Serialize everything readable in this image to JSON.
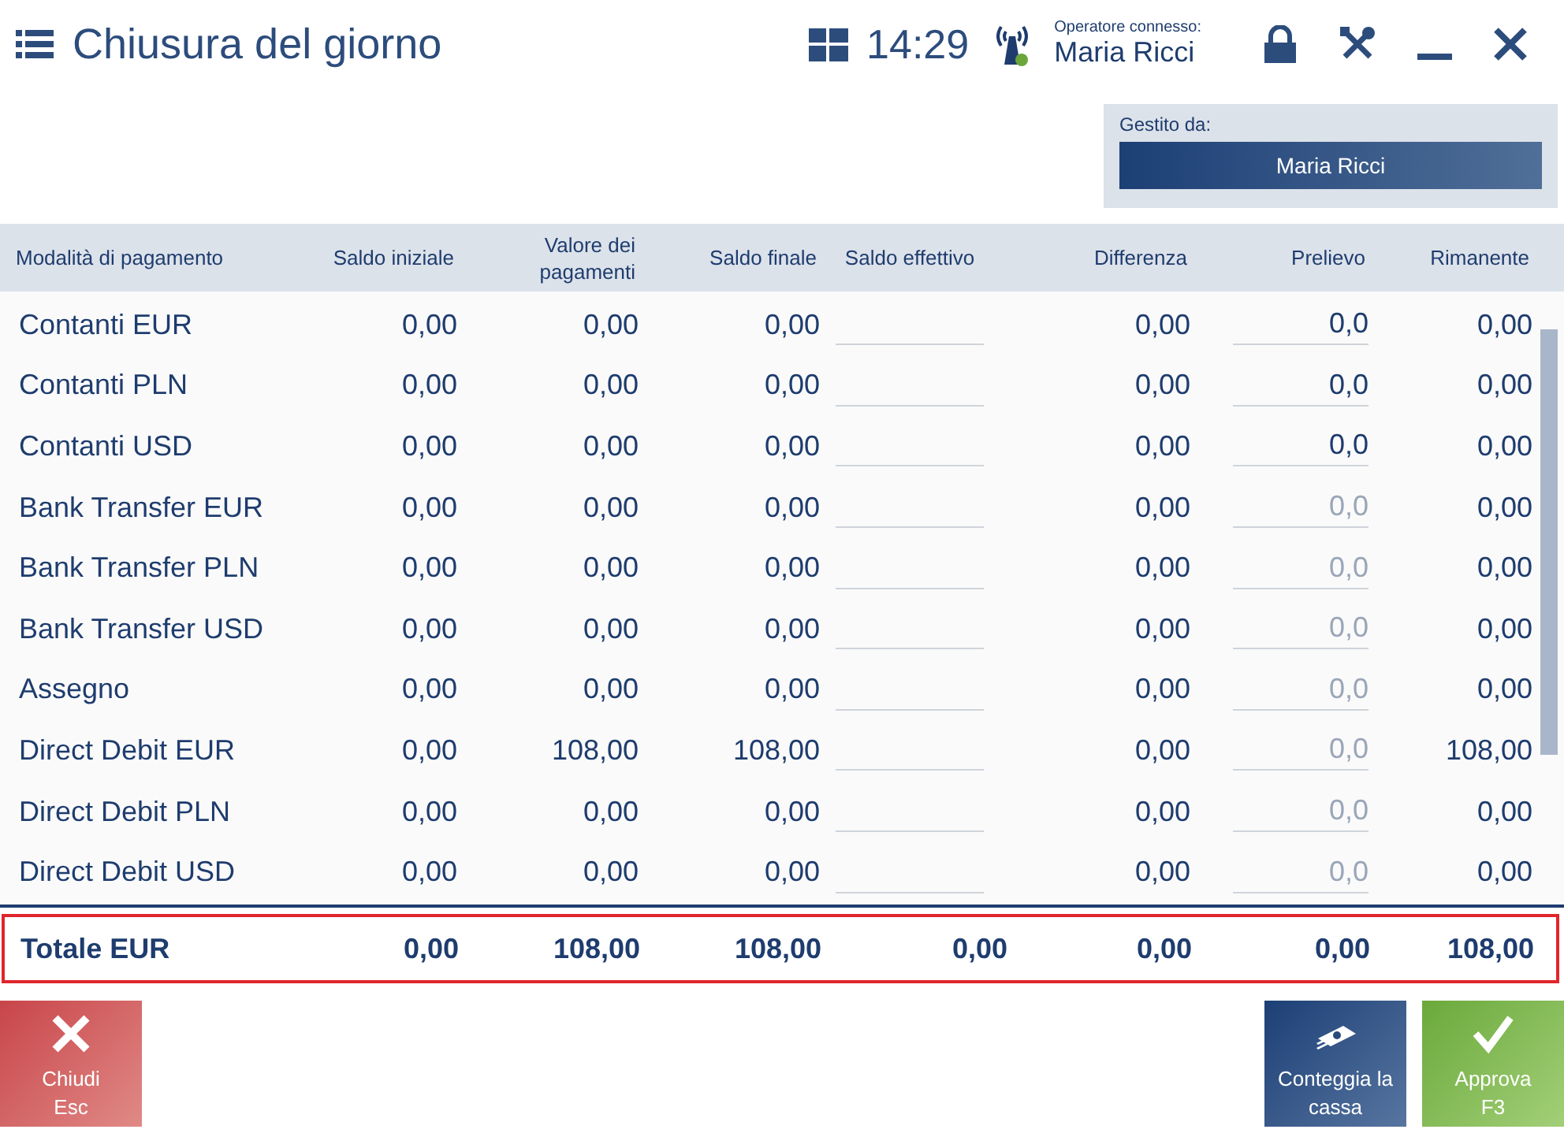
{
  "header": {
    "title": "Chiusura del giorno",
    "time": "14:29",
    "operator_label": "Operatore connesso:",
    "operator_name": "Maria Ricci"
  },
  "managed_by": {
    "label": "Gestito da:",
    "name": "Maria Ricci"
  },
  "table": {
    "columns": [
      "Modalità di pagamento",
      "Saldo iniziale",
      "Valore dei pagamenti",
      "Saldo finale",
      "Saldo effettivo",
      "Differenza",
      "Prelievo",
      "Rimanente"
    ],
    "rows": [
      {
        "name": "Contanti EUR",
        "initial": "0,00",
        "payments": "0,00",
        "final": "0,00",
        "difference": "0,00",
        "withdrawal": {
          "value": "0,0",
          "disabled": false
        },
        "remaining": "0,00"
      },
      {
        "name": "Contanti PLN",
        "initial": "0,00",
        "payments": "0,00",
        "final": "0,00",
        "difference": "0,00",
        "withdrawal": {
          "value": "0,0",
          "disabled": false
        },
        "remaining": "0,00"
      },
      {
        "name": "Contanti USD",
        "initial": "0,00",
        "payments": "0,00",
        "final": "0,00",
        "difference": "0,00",
        "withdrawal": {
          "value": "0,0",
          "disabled": false
        },
        "remaining": "0,00"
      },
      {
        "name": "Bank Transfer EUR",
        "initial": "0,00",
        "payments": "0,00",
        "final": "0,00",
        "difference": "0,00",
        "withdrawal": {
          "value": "0,0",
          "disabled": true
        },
        "remaining": "0,00"
      },
      {
        "name": "Bank Transfer PLN",
        "initial": "0,00",
        "payments": "0,00",
        "final": "0,00",
        "difference": "0,00",
        "withdrawal": {
          "value": "0,0",
          "disabled": true
        },
        "remaining": "0,00"
      },
      {
        "name": "Bank Transfer USD",
        "initial": "0,00",
        "payments": "0,00",
        "final": "0,00",
        "difference": "0,00",
        "withdrawal": {
          "value": "0,0",
          "disabled": true
        },
        "remaining": "0,00"
      },
      {
        "name": "Assegno",
        "initial": "0,00",
        "payments": "0,00",
        "final": "0,00",
        "difference": "0,00",
        "withdrawal": {
          "value": "0,0",
          "disabled": true
        },
        "remaining": "0,00"
      },
      {
        "name": "Direct Debit EUR",
        "initial": "0,00",
        "payments": "108,00",
        "final": "108,00",
        "difference": "0,00",
        "withdrawal": {
          "value": "0,0",
          "disabled": true
        },
        "remaining": "108,00"
      },
      {
        "name": "Direct Debit PLN",
        "initial": "0,00",
        "payments": "0,00",
        "final": "0,00",
        "difference": "0,00",
        "withdrawal": {
          "value": "0,0",
          "disabled": true
        },
        "remaining": "0,00"
      },
      {
        "name": "Direct Debit USD",
        "initial": "0,00",
        "payments": "0,00",
        "final": "0,00",
        "difference": "0,00",
        "withdrawal": {
          "value": "0,0",
          "disabled": true
        },
        "remaining": "0,00"
      }
    ],
    "total": {
      "label": "Totale EUR",
      "values": [
        "0,00",
        "108,00",
        "108,00",
        "0,00",
        "0,00",
        "0,00",
        "108,00"
      ]
    }
  },
  "buttons": [
    {
      "kind": "close",
      "lines": [
        "Chiudi",
        "Esc"
      ]
    },
    {
      "kind": "count",
      "lines": [
        "Conteggia la",
        "cassa"
      ]
    },
    {
      "kind": "approve",
      "lines": [
        "Approva",
        "F3"
      ]
    }
  ]
}
